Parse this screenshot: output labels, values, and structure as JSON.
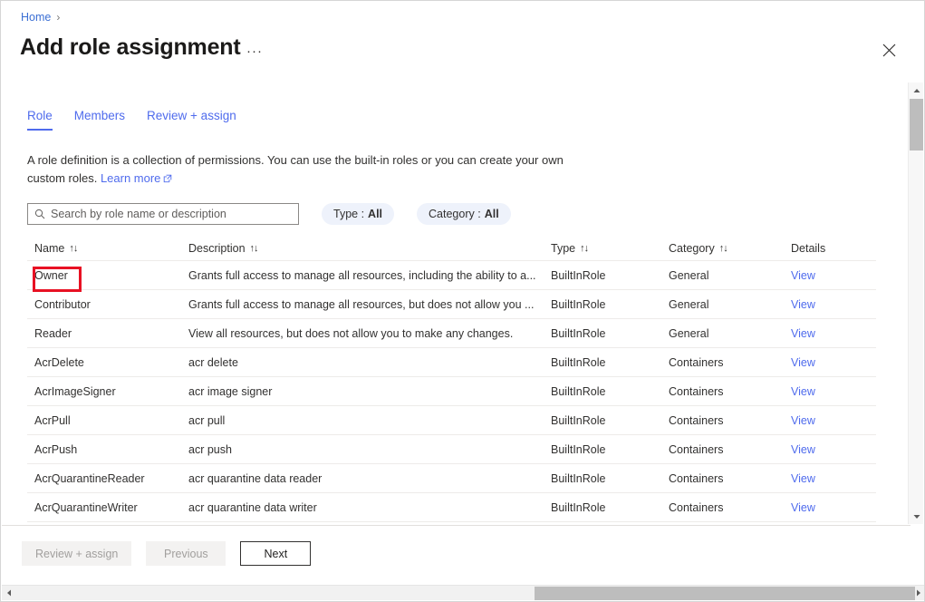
{
  "breadcrumb": {
    "items": [
      "Home"
    ],
    "separator": "›"
  },
  "header": {
    "title": "Add role assignment",
    "more_menu": "···",
    "close_icon": "close-icon"
  },
  "tabs": [
    {
      "label": "Role",
      "active": true
    },
    {
      "label": "Members",
      "active": false
    },
    {
      "label": "Review + assign",
      "active": false
    }
  ],
  "description": {
    "text": "A role definition is a collection of permissions. You can use the built-in roles or you can create your own custom roles.",
    "link_label": "Learn more",
    "link_icon": "external-link-icon"
  },
  "filters": {
    "search": {
      "icon": "search-icon",
      "placeholder": "Search by role name or description",
      "value": ""
    },
    "pills": [
      {
        "label": "Type :",
        "value": "All"
      },
      {
        "label": "Category :",
        "value": "All"
      }
    ]
  },
  "table": {
    "columns": [
      {
        "label": "Name",
        "sortable": true
      },
      {
        "label": "Description",
        "sortable": true
      },
      {
        "label": "Type",
        "sortable": true
      },
      {
        "label": "Category",
        "sortable": true
      },
      {
        "label": "Details",
        "sortable": false
      }
    ],
    "sort_icon": "↑↓",
    "details_link_label": "View",
    "rows": [
      {
        "name": "Owner",
        "description": "Grants full access to manage all resources, including the ability to a...",
        "type": "BuiltInRole",
        "category": "General",
        "details": "View",
        "highlighted": true
      },
      {
        "name": "Contributor",
        "description": "Grants full access to manage all resources, but does not allow you ...",
        "type": "BuiltInRole",
        "category": "General",
        "details": "View",
        "highlighted": false
      },
      {
        "name": "Reader",
        "description": "View all resources, but does not allow you to make any changes.",
        "type": "BuiltInRole",
        "category": "General",
        "details": "View",
        "highlighted": false
      },
      {
        "name": "AcrDelete",
        "description": "acr delete",
        "type": "BuiltInRole",
        "category": "Containers",
        "details": "View",
        "highlighted": false
      },
      {
        "name": "AcrImageSigner",
        "description": "acr image signer",
        "type": "BuiltInRole",
        "category": "Containers",
        "details": "View",
        "highlighted": false
      },
      {
        "name": "AcrPull",
        "description": "acr pull",
        "type": "BuiltInRole",
        "category": "Containers",
        "details": "View",
        "highlighted": false
      },
      {
        "name": "AcrPush",
        "description": "acr push",
        "type": "BuiltInRole",
        "category": "Containers",
        "details": "View",
        "highlighted": false
      },
      {
        "name": "AcrQuarantineReader",
        "description": "acr quarantine data reader",
        "type": "BuiltInRole",
        "category": "Containers",
        "details": "View",
        "highlighted": false
      },
      {
        "name": "AcrQuarantineWriter",
        "description": "acr quarantine data writer",
        "type": "BuiltInRole",
        "category": "Containers",
        "details": "View",
        "highlighted": false
      }
    ]
  },
  "footer": {
    "buttons": [
      {
        "label": "Review + assign",
        "state": "disabled"
      },
      {
        "label": "Previous",
        "state": "disabled"
      },
      {
        "label": "Next",
        "state": "enabled"
      }
    ]
  },
  "colors": {
    "link": "#4f6bed",
    "highlight_box": "#e81123",
    "pill_background": "#eef2fb",
    "text": "#323130"
  }
}
